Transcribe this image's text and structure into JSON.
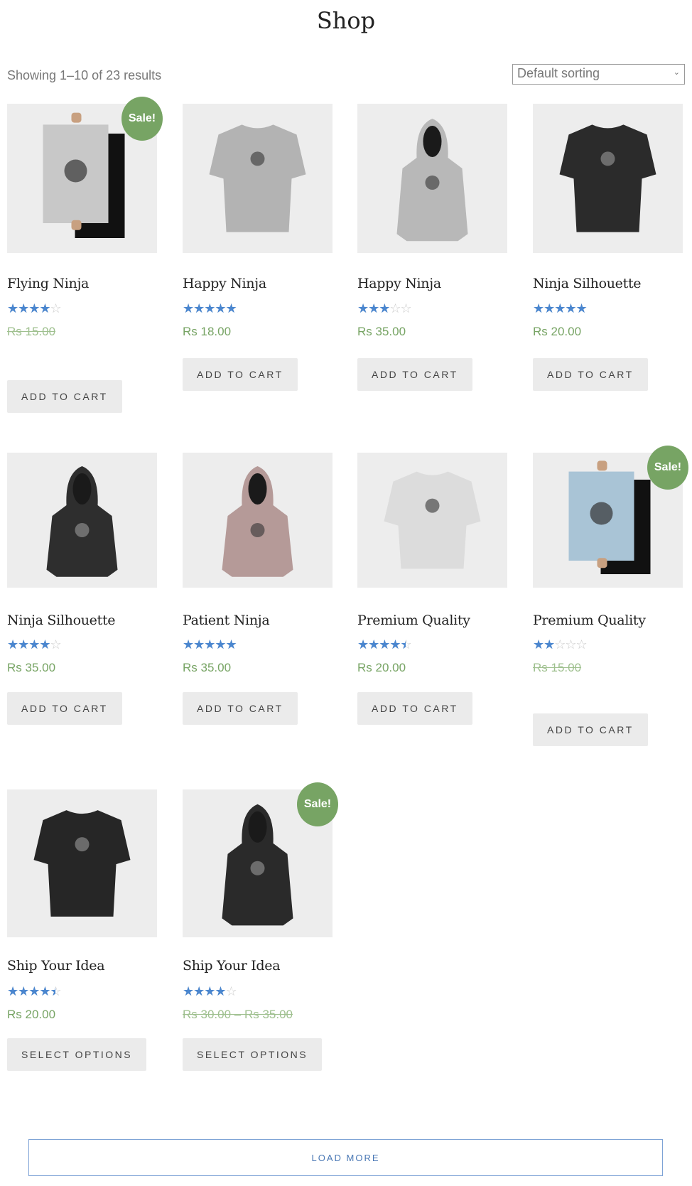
{
  "page": {
    "title": "Shop",
    "result_count": "Showing 1–10 of 23 results"
  },
  "sorting": {
    "selected": "Default sorting"
  },
  "colors": {
    "price": "#77a464",
    "sale_badge": "#77a464",
    "stars": "#4a86cf",
    "button_bg": "#ebebeb",
    "load_more_border": "#7ea3d6"
  },
  "products": [
    {
      "name": "Flying Ninja",
      "rating": 4,
      "price": "Rs 15.00",
      "sale": true,
      "sale_label": "Sale!",
      "button": "ADD TO CART",
      "image": {
        "kind": "poster",
        "color": "#c8c8c8"
      }
    },
    {
      "name": "Happy Ninja",
      "rating": 5,
      "price": "Rs 18.00",
      "sale": false,
      "button": "ADD TO CART",
      "image": {
        "kind": "tee",
        "color": "#b3b3b3"
      }
    },
    {
      "name": "Happy Ninja",
      "rating": 3,
      "price": "Rs 35.00",
      "sale": false,
      "button": "ADD TO CART",
      "image": {
        "kind": "hoodie",
        "color": "#b8b8b8"
      }
    },
    {
      "name": "Ninja Silhouette",
      "rating": 5,
      "price": "Rs 20.00",
      "sale": false,
      "button": "ADD TO CART",
      "image": {
        "kind": "tee",
        "color": "#2b2b2b"
      }
    },
    {
      "name": "Ninja Silhouette",
      "rating": 4,
      "price": "Rs 35.00",
      "sale": false,
      "button": "ADD TO CART",
      "image": {
        "kind": "hoodie",
        "color": "#2e2e2e"
      }
    },
    {
      "name": "Patient Ninja",
      "rating": 5,
      "price": "Rs 35.00",
      "sale": false,
      "button": "ADD TO CART",
      "image": {
        "kind": "hoodie",
        "color": "#b59a98"
      }
    },
    {
      "name": "Premium Quality",
      "rating": 4.5,
      "price": "Rs 20.00",
      "sale": false,
      "button": "ADD TO CART",
      "image": {
        "kind": "tee",
        "color": "#dcdcdc"
      }
    },
    {
      "name": "Premium Quality",
      "rating": 2,
      "price": "Rs 15.00",
      "sale": true,
      "sale_label": "Sale!",
      "button": "ADD TO CART",
      "image": {
        "kind": "poster",
        "color": "#a9c4d6"
      }
    },
    {
      "name": "Ship Your Idea",
      "rating": 4.5,
      "price": "Rs 20.00",
      "sale": false,
      "button": "SELECT OPTIONS",
      "image": {
        "kind": "tee",
        "color": "#262626"
      }
    },
    {
      "name": "Ship Your Idea",
      "rating": 4,
      "price": "Rs 30.00 – Rs 35.00",
      "sale": true,
      "sale_label": "Sale!",
      "button": "SELECT OPTIONS",
      "image": {
        "kind": "hoodie",
        "color": "#2a2a2a"
      }
    }
  ],
  "load_more": "LOAD MORE"
}
